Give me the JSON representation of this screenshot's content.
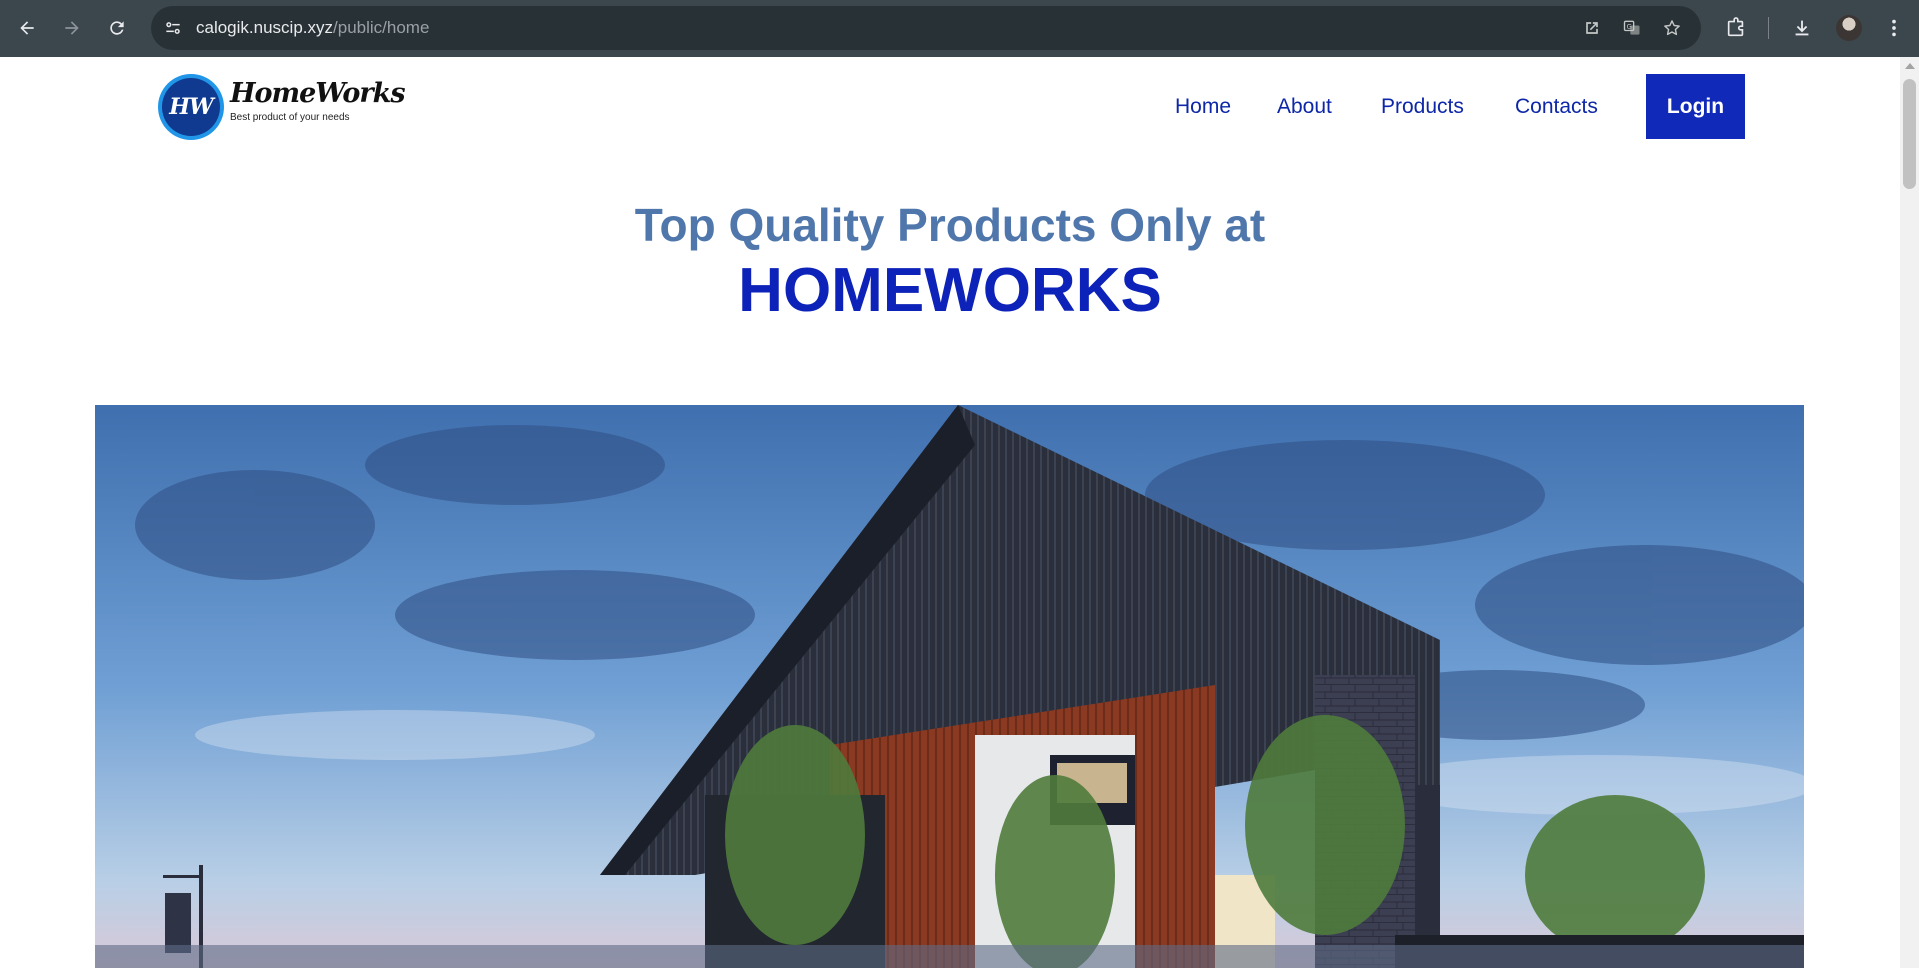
{
  "browser": {
    "url_host": "calogik.nuscip.xyz",
    "url_path": "/public/home"
  },
  "site": {
    "logo": {
      "badge": "HW",
      "name": "HomeWorks",
      "tagline": "Best product of your needs"
    },
    "nav": [
      {
        "label": "Home"
      },
      {
        "label": "About"
      },
      {
        "label": "Products"
      },
      {
        "label": "Contacts"
      }
    ],
    "login_label": "Login"
  },
  "hero": {
    "subtitle": "Top Quality Products Only at",
    "title": "HOMEWORKS"
  },
  "colors": {
    "brand_blue": "#1129b8",
    "nav_text": "#0d27a8",
    "subtitle": "#4f77ac"
  }
}
